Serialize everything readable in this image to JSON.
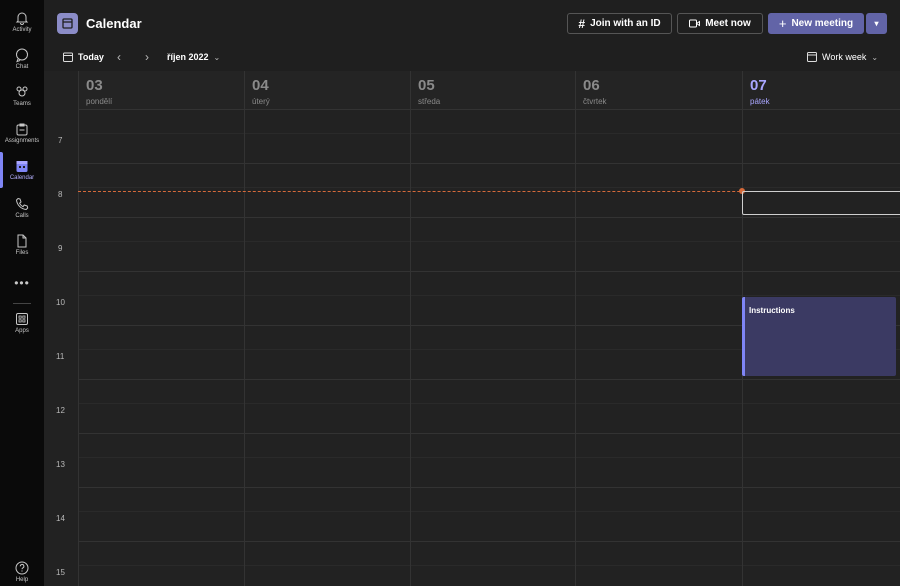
{
  "rail": [
    {
      "label": "Activity",
      "icon": "bell-icon"
    },
    {
      "label": "Chat",
      "icon": "chat-icon"
    },
    {
      "label": "Teams",
      "icon": "teams-icon"
    },
    {
      "label": "Assignments",
      "icon": "assignments-icon"
    },
    {
      "label": "Calendar",
      "icon": "calendar-icon"
    },
    {
      "label": "Calls",
      "icon": "phone-icon"
    },
    {
      "label": "Files",
      "icon": "file-icon"
    },
    {
      "label": "Apps",
      "icon": "apps-icon"
    },
    {
      "label": "Help",
      "icon": "help-icon"
    }
  ],
  "header": {
    "title": "Calendar",
    "join_label": "Join with an ID",
    "meet_label": "Meet now",
    "new_label": "New meeting"
  },
  "subbar": {
    "today_label": "Today",
    "month_label": "říjen 2022",
    "view_label": "Work week"
  },
  "days": [
    {
      "num": "03",
      "name": "pondělí"
    },
    {
      "num": "04",
      "name": "úterý"
    },
    {
      "num": "05",
      "name": "středa"
    },
    {
      "num": "06",
      "name": "čtvrtek"
    },
    {
      "num": "07",
      "name": "pátek"
    }
  ],
  "hours": [
    "7",
    "8",
    "9",
    "10",
    "11",
    "12",
    "13",
    "14",
    "15"
  ],
  "events": [
    {
      "title": "Instructions",
      "day": "07",
      "start": "10:00",
      "end": "11:30"
    },
    {
      "title": "",
      "day": "07",
      "start": "8:00",
      "end": "8:30"
    }
  ],
  "colors": {
    "accent": "#6264a7",
    "today": "#a9a6ff",
    "now_line": "#d66a3a"
  }
}
